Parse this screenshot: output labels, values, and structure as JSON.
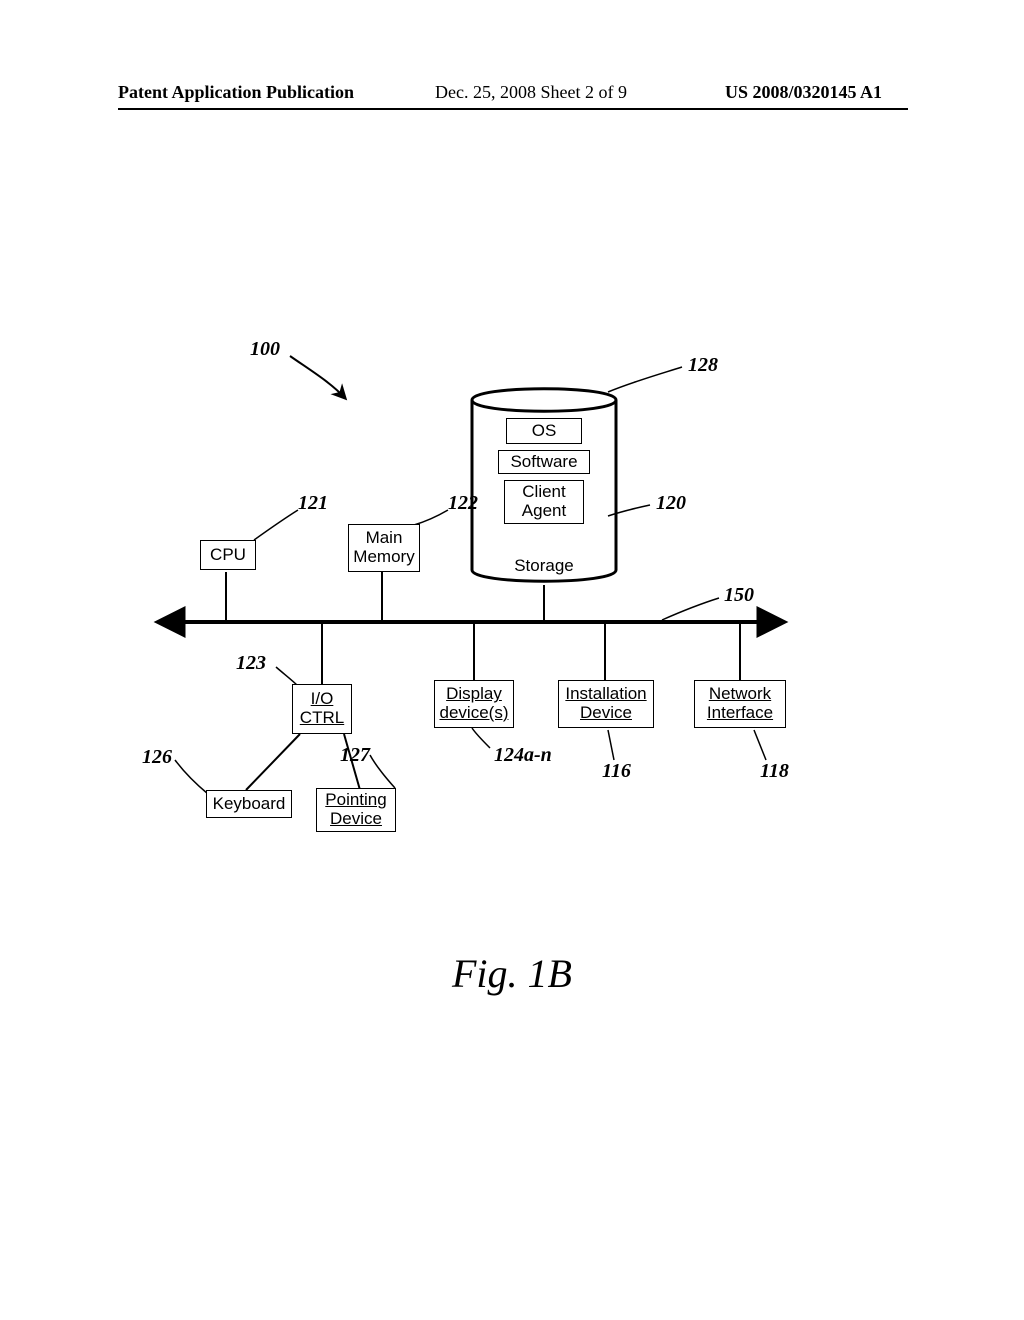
{
  "header": {
    "left": "Patent Application Publication",
    "center": "Dec. 25, 2008  Sheet 2 of 9",
    "right": "US 2008/0320145 A1"
  },
  "refs": {
    "r100": "100",
    "r128": "128",
    "r121": "121",
    "r122": "122",
    "r120": "120",
    "r150": "150",
    "r123": "123",
    "r124": "124a-n",
    "r116": "116",
    "r118": "118",
    "r126": "126",
    "r127": "127"
  },
  "blocks": {
    "cpu": "CPU",
    "main_memory": "Main\nMemory",
    "os": "OS",
    "software": "Software",
    "client_agent": "Client\nAgent",
    "storage": "Storage",
    "io_ctrl": "I/O\nCTRL",
    "display": "Display\ndevice(s)",
    "installation": "Installation\nDevice",
    "network": "Network\nInterface",
    "keyboard": "Keyboard",
    "pointing": "Pointing\nDevice"
  },
  "figcaption": "Fig. 1B"
}
